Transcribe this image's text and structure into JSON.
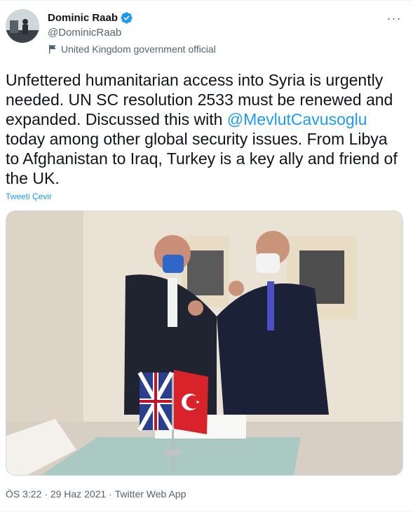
{
  "author": {
    "display_name": "Dominic Raab",
    "handle": "@DominicRaab",
    "label": "United Kingdom government official"
  },
  "tweet": {
    "text_part1": "Unfettered humanitarian access into Syria is urgently needed. UN SC resolution 2533 must be renewed and expanded. Discussed this with ",
    "mention": "@MevlutCavusoglu",
    "text_part2": " today among other global security issues. From Libya to Afghanistan to Iraq, Turkey is a key ally and friend of the UK.",
    "translate": "Tweeti Çevir"
  },
  "meta": {
    "time": "ÖS 3:22",
    "separator": " · ",
    "date": "29 Haz 2021",
    "source": "Twitter Web App"
  },
  "icons": {
    "verified": "verified-badge-icon",
    "label": "flag-icon",
    "more": "more-icon"
  },
  "colors": {
    "accent": "#1d9bf0",
    "secondary_text": "#536471",
    "primary_text": "#0f1419"
  }
}
